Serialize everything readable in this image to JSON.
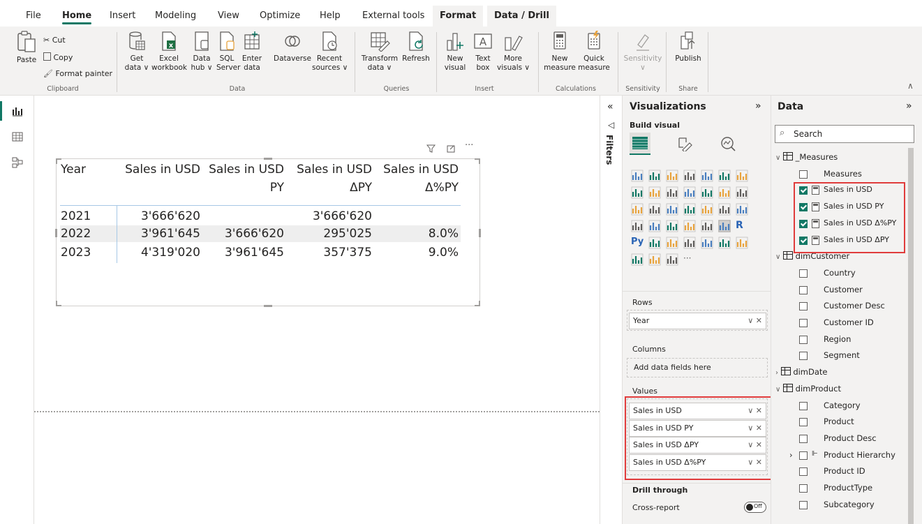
{
  "tabs": [
    {
      "label": "File",
      "active": false
    },
    {
      "label": "Home",
      "active": true
    },
    {
      "label": "Insert",
      "active": false
    },
    {
      "label": "Modeling",
      "active": false
    },
    {
      "label": "View",
      "active": false
    },
    {
      "label": "Optimize",
      "active": false
    },
    {
      "label": "Help",
      "active": false
    },
    {
      "label": "External tools",
      "active": false
    },
    {
      "label": "Format",
      "active": false
    },
    {
      "label": "Data / Drill",
      "active": false
    }
  ],
  "ribbon": {
    "clipboard": {
      "paste": "Paste",
      "cut": "Cut",
      "copy": "Copy",
      "format_painter": "Format painter",
      "label": "Clipboard"
    },
    "data": {
      "get_data": [
        "Get",
        "data ∨"
      ],
      "excel": [
        "Excel",
        "workbook"
      ],
      "data_hub": [
        "Data",
        "hub ∨"
      ],
      "sql": [
        "SQL",
        "Server"
      ],
      "enter": [
        "Enter",
        "data"
      ],
      "dataverse": "Dataverse",
      "recent": [
        "Recent",
        "sources ∨"
      ],
      "label": "Data"
    },
    "queries": {
      "transform": [
        "Transform",
        "data ∨"
      ],
      "refresh": "Refresh",
      "label": "Queries"
    },
    "insert": {
      "new_visual": [
        "New",
        "visual"
      ],
      "text_box": [
        "Text",
        "box"
      ],
      "more_visuals": [
        "More",
        "visuals ∨"
      ],
      "label": "Insert"
    },
    "calculations": {
      "new_measure": [
        "New",
        "measure"
      ],
      "quick_measure": [
        "Quick",
        "measure"
      ],
      "label": "Calculations"
    },
    "sensitivity": {
      "button": "Sensitivity",
      "label": "Sensitivity"
    },
    "share": {
      "publish": "Publish",
      "label": "Share"
    }
  },
  "table": {
    "headers": [
      [
        "Year",
        ""
      ],
      [
        "Sales in USD",
        ""
      ],
      [
        "Sales in USD",
        "PY"
      ],
      [
        "Sales in USD",
        "ΔPY"
      ],
      [
        "Sales in USD",
        "Δ%PY"
      ]
    ],
    "rows": [
      [
        "2021",
        "3'666'620",
        "",
        "3'666'620",
        ""
      ],
      [
        "2022",
        "3'961'645",
        "3'666'620",
        "295'025",
        "8.0%"
      ],
      [
        "2023",
        "4'319'020",
        "3'961'645",
        "357'375",
        "9.0%"
      ]
    ]
  },
  "filters": {
    "label": "Filters"
  },
  "visualizations": {
    "title": "Visualizations",
    "build_visual": "Build visual",
    "rows_label": "Rows",
    "rows_field": "Year",
    "columns_label": "Columns",
    "columns_placeholder": "Add data fields here",
    "values_label": "Values",
    "values": [
      "Sales in USD",
      "Sales in USD PY",
      "Sales in USD ΔPY",
      "Sales in USD Δ%PY"
    ],
    "drill_through": "Drill through",
    "cross_report": "Cross-report",
    "toggle_off": "Off",
    "more": "···"
  },
  "data_pane": {
    "title": "Data",
    "search_placeholder": "Search",
    "tables": [
      {
        "name": "_Measures",
        "fields": [
          {
            "name": "Measures",
            "checked": false,
            "type": "plain"
          },
          {
            "name": "Sales in USD",
            "checked": true,
            "type": "measure"
          },
          {
            "name": "Sales in USD PY",
            "checked": true,
            "type": "measure"
          },
          {
            "name": "Sales in USD Δ%PY",
            "checked": true,
            "type": "measure"
          },
          {
            "name": "Sales in USD ΔPY",
            "checked": true,
            "type": "measure"
          }
        ]
      },
      {
        "name": "dimCustomer",
        "fields": [
          {
            "name": "Country"
          },
          {
            "name": "Customer"
          },
          {
            "name": "Customer Desc"
          },
          {
            "name": "Customer ID"
          },
          {
            "name": "Region"
          },
          {
            "name": "Segment"
          }
        ]
      },
      {
        "name": "dimDate",
        "fields": []
      },
      {
        "name": "dimProduct",
        "fields": [
          {
            "name": "Category"
          },
          {
            "name": "Product"
          },
          {
            "name": "Product Desc"
          },
          {
            "name": "Product Hierarchy"
          },
          {
            "name": "Product ID"
          },
          {
            "name": "ProductType"
          },
          {
            "name": "Subcategory"
          }
        ]
      }
    ]
  },
  "colors": {
    "accent": "#117865",
    "highlight": "#e03c3c",
    "pane_bg": "#f3f2f1"
  }
}
